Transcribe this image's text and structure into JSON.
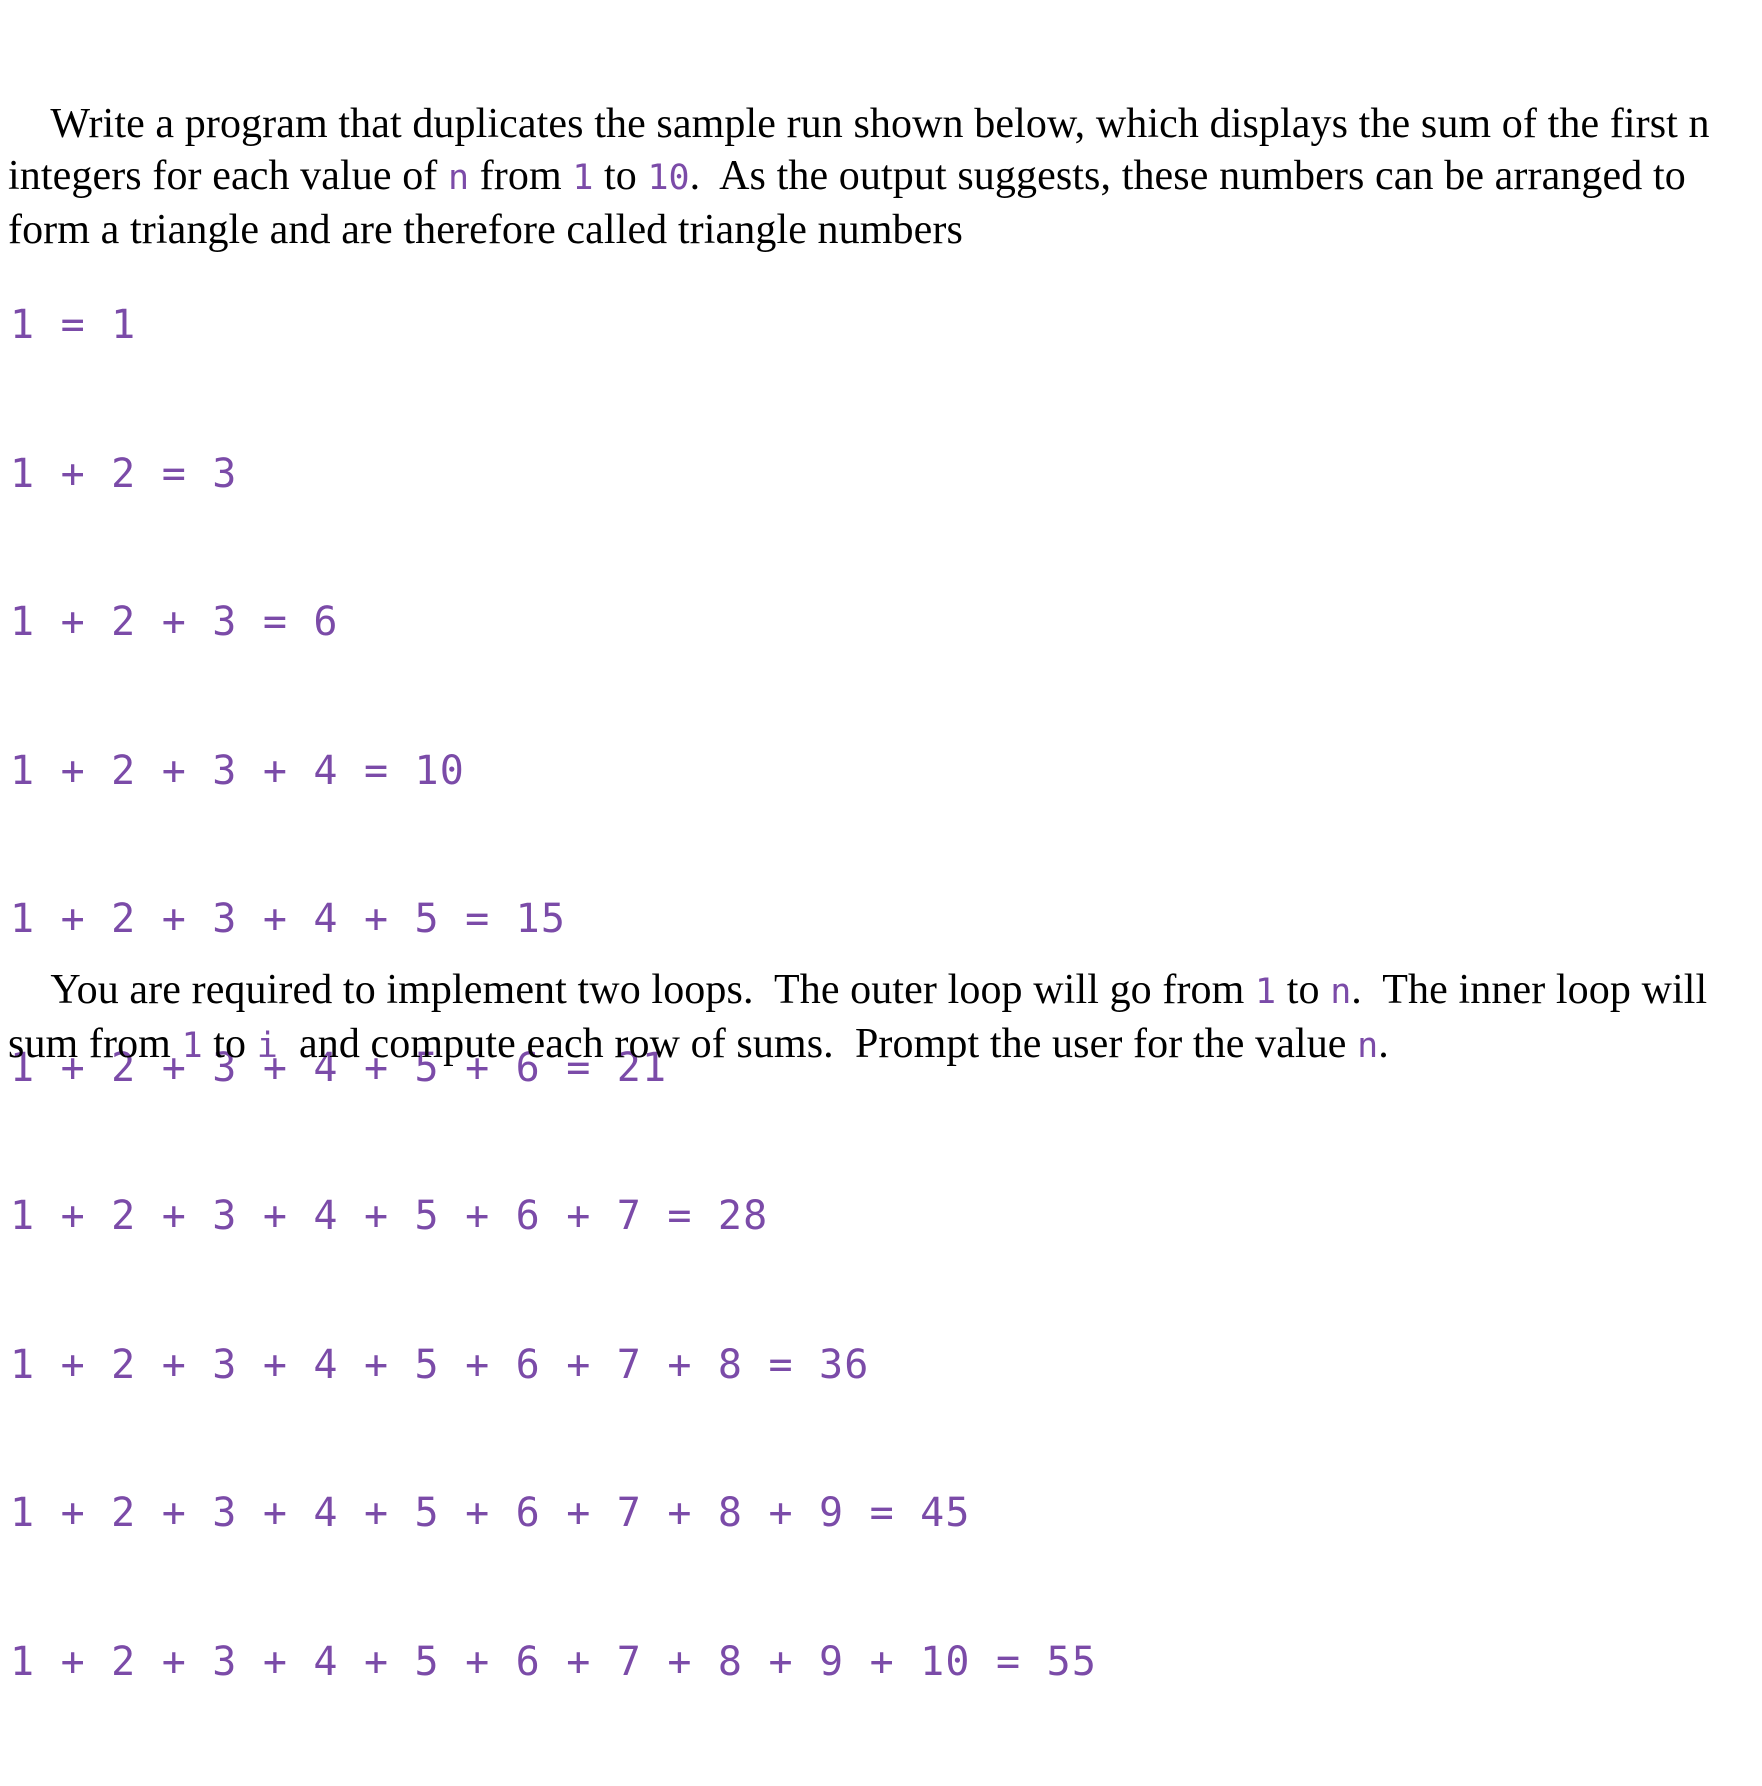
{
  "page": {
    "background_color": "#ffffff",
    "text_color": "#000000",
    "code_color": "#7b4ba8"
  },
  "intro_paragraph": {
    "segments": [
      {
        "kind": "text",
        "value": "Write a program that duplicates the sample run shown below, which displays the sum of the first n integers for each value of "
      },
      {
        "kind": "code",
        "value": "n"
      },
      {
        "kind": "text",
        "value": " from "
      },
      {
        "kind": "code",
        "value": "1"
      },
      {
        "kind": "text",
        "value": " to "
      },
      {
        "kind": "code",
        "value": "10"
      },
      {
        "kind": "text",
        "value": ".  As the output suggests, these numbers can be arranged to form a triangle and are therefore called triangle numbers"
      }
    ],
    "plain": "Write a program that duplicates the sample run shown below, which displays the sum of the first n integers for each value of n from 1 to 10.  As the output suggests, these numbers can be arranged to form a triangle and are therefore called triangle numbers"
  },
  "sample_output": {
    "lines": [
      "1 = 1",
      "1 + 2 = 3",
      "1 + 2 + 3 = 6",
      "1 + 2 + 3 + 4 = 10",
      "1 + 2 + 3 + 4 + 5 = 15",
      "1 + 2 + 3 + 4 + 5 + 6 = 21",
      "1 + 2 + 3 + 4 + 5 + 6 + 7 = 28",
      "1 + 2 + 3 + 4 + 5 + 6 + 7 + 8 = 36",
      "1 + 2 + 3 + 4 + 5 + 6 + 7 + 8 + 9 = 45",
      "1 + 2 + 3 + 4 + 5 + 6 + 7 + 8 + 9 + 10 = 55"
    ],
    "triangle_numbers": [
      1,
      3,
      6,
      10,
      15,
      21,
      28,
      36,
      45,
      55
    ],
    "n_values": [
      1,
      2,
      3,
      4,
      5,
      6,
      7,
      8,
      9,
      10
    ]
  },
  "outro_paragraph": {
    "segments": [
      {
        "kind": "text",
        "value": "You are required to implement two loops.  The outer loop will go from "
      },
      {
        "kind": "code",
        "value": "1"
      },
      {
        "kind": "text",
        "value": " to "
      },
      {
        "kind": "code",
        "value": "n"
      },
      {
        "kind": "text",
        "value": ".  The inner loop will sum from "
      },
      {
        "kind": "code",
        "value": "1"
      },
      {
        "kind": "text",
        "value": " to "
      },
      {
        "kind": "code",
        "value": "i"
      },
      {
        "kind": "text",
        "value": "  and compute each row of sums.  Prompt the user for the value "
      },
      {
        "kind": "code",
        "value": "n"
      },
      {
        "kind": "text",
        "value": "."
      }
    ],
    "plain": "You are required to implement two loops.  The outer loop will go from 1 to n.  The inner loop will sum from 1 to i  and compute each row of sums.  Prompt the user for the value n."
  }
}
